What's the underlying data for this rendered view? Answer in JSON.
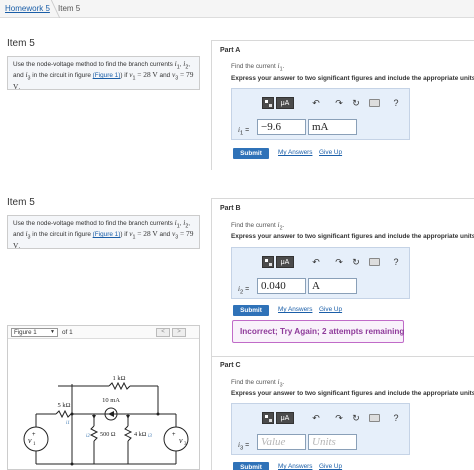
{
  "breadcrumb": {
    "link": "Homework 5",
    "current": "Item 5"
  },
  "items": [
    {
      "title": "Item 5",
      "question": {
        "pre": "Use the node-voltage method to find the branch currents",
        "i1": "i",
        "i1sub": "1",
        "i2": "i",
        "i2sub": "2",
        "and": "and",
        "i3": "i",
        "i3sub": "3",
        "mid": "in the circuit in figure",
        "figlink": "(Figure 1)",
        "if": ") if",
        "v1": "v",
        "v1sub": "1",
        "eq1": "= 28 V",
        "and2": "and",
        "v3": "v",
        "v3sub": "3",
        "eq2": "= 79 V",
        "dot": "."
      }
    },
    {
      "title": "Item 5",
      "question": {
        "pre": "Use the node-voltage method to find the branch currents",
        "i1": "i",
        "i1sub": "1",
        "i2": "i",
        "i2sub": "2",
        "and": "and",
        "i3": "i",
        "i3sub": "3",
        "mid": "in the circuit in figure",
        "figlink": "(Figure 1)",
        "if": ") if",
        "v1": "v",
        "v1sub": "1",
        "eq1": "= 28 V",
        "and2": "and",
        "v3": "v",
        "v3sub": "3",
        "eq2": "= 79 V",
        "dot": "."
      }
    }
  ],
  "parts": [
    {
      "title": "Part A",
      "find": "Find the current",
      "var": "i",
      "sub": "1",
      "express": "Express your answer to two significant figures and include the appropriate units.",
      "toolbar_mu": "μA",
      "value": "−9.6",
      "unit": "mA",
      "submit": "Submit",
      "my_answers": "My Answers",
      "give_up": "Give Up"
    },
    {
      "title": "Part B",
      "find": "Find the current",
      "var": "i",
      "sub": "2",
      "express": "Express your answer to two significant figures and include the appropriate units.",
      "toolbar_mu": "μA",
      "value": "0.040",
      "unit": "A",
      "submit": "Submit",
      "my_answers": "My Answers",
      "give_up": "Give Up",
      "feedback": "Incorrect; Try Again; 2 attempts remaining"
    },
    {
      "title": "Part C",
      "find": "Find the current",
      "var": "i",
      "sub": "3",
      "express": "Express your answer to two significant figures and include the appropriate units.",
      "toolbar_mu": "μA",
      "value_placeholder": "Value",
      "unit_placeholder": "Units",
      "submit": "Submit",
      "my_answers": "My Answers",
      "give_up": "Give Up"
    }
  ],
  "figure": {
    "select": "Figure 1",
    "of": "of 1",
    "prev": "<",
    "next": ">",
    "labels": {
      "r_top": "1 kΩ",
      "r_left": "5 kΩ",
      "src": "10 mA",
      "r_mid1": "500 Ω",
      "r_mid2": "4 kΩ",
      "v1": "v",
      "v1sub": "1",
      "v3": "v",
      "v3sub": "3",
      "i1": "i1",
      "i2": "i2",
      "i3": "i3"
    }
  },
  "colors": {
    "link": "#1a5ea8",
    "submit": "#2f72b8",
    "panel": "#e6effa",
    "feedback": "#8e3a9a"
  }
}
